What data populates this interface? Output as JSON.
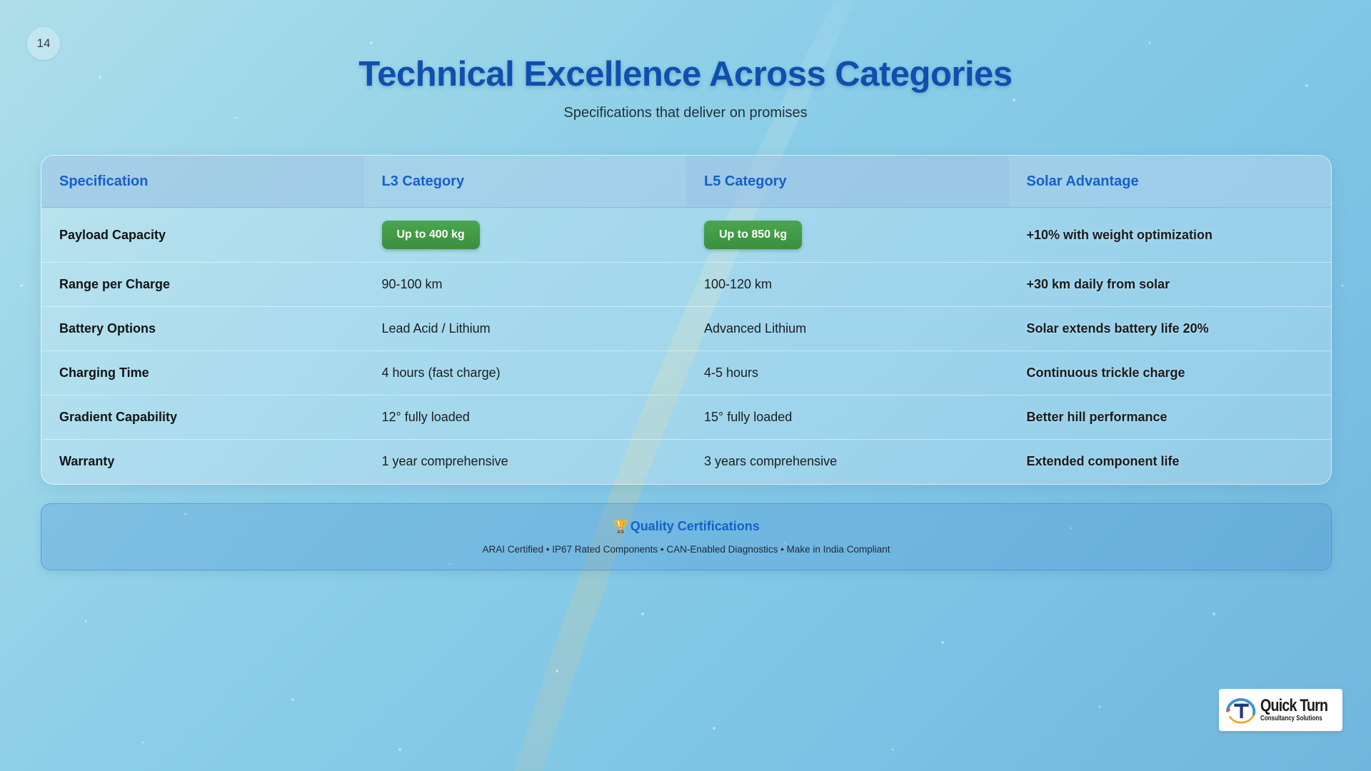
{
  "slide": {
    "number": "14",
    "title": "Technical Excellence Across Categories",
    "subtitle": "Specifications that deliver on promises"
  },
  "table": {
    "headers": [
      "Specification",
      "L3 Category",
      "L5 Category",
      "Solar Advantage"
    ],
    "rows": [
      {
        "spec": "Payload Capacity",
        "l3": "Up to 400 kg",
        "l5": "Up to 850 kg",
        "solar": "+10% with weight optimization",
        "highlight": true
      },
      {
        "spec": "Range per Charge",
        "l3": "90-100 km",
        "l5": "100-120 km",
        "solar": "+30 km daily from solar"
      },
      {
        "spec": "Battery Options",
        "l3": "Lead Acid / Lithium",
        "l5": "Advanced Lithium",
        "solar": "Solar extends battery life 20%"
      },
      {
        "spec": "Charging Time",
        "l3": "4 hours (fast charge)",
        "l5": "4-5 hours",
        "solar": "Continuous trickle charge"
      },
      {
        "spec": "Gradient Capability",
        "l3": "12° fully loaded",
        "l5": "15° fully loaded",
        "solar": "Better hill performance"
      },
      {
        "spec": "Warranty",
        "l3": "1 year comprehensive",
        "l5": "3 years comprehensive",
        "solar": "Extended component life"
      }
    ]
  },
  "certifications": {
    "icon": "trophy-icon",
    "title": "Quality Certifications",
    "list": "ARAI Certified • IP67 Rated Components • CAN-Enabled Diagnostics • Make in India Compliant"
  },
  "logo": {
    "icon": "quickturn-logo-icon",
    "name": "Quick Turn",
    "tagline": "Consultancy Solutions"
  },
  "colors": {
    "title": "#0f4fae",
    "header_text": "#1560c9",
    "pill": "#3f9a43",
    "cert_title": "#1462c7"
  }
}
